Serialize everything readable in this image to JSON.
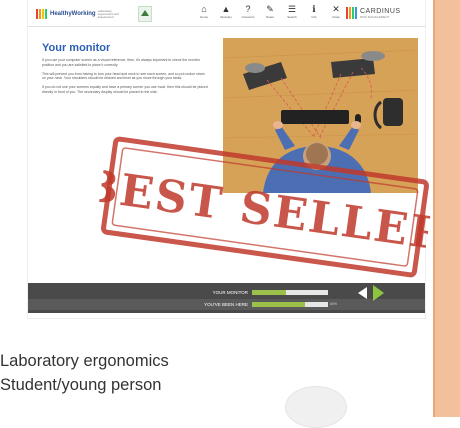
{
  "colors": {
    "brand_blue": "#2b5fb5",
    "rail": "#f2c09a",
    "bar_bg": "#4a4a4a",
    "progress_green": "#9bc14a",
    "stamp_red": "#c0392b"
  },
  "app": {
    "brand_name": "HealthyWorking",
    "brand_sub": "ergonomics",
    "brand_tagline": "Laboratory ergonomics self assessment",
    "partner_name": "CARDINUS",
    "partner_sub": "RISK MANAGEMENT"
  },
  "nav": [
    {
      "label": "Home",
      "icon": "house-icon",
      "glyph": "⌂"
    },
    {
      "label": "Glossary",
      "icon": "car-icon",
      "glyph": "▲"
    },
    {
      "label": "Concerns",
      "icon": "help-icon",
      "glyph": "?"
    },
    {
      "label": "Notes",
      "icon": "pen-icon",
      "glyph": "✎"
    },
    {
      "label": "Search",
      "icon": "menu-icon",
      "glyph": "☰"
    },
    {
      "label": "Info",
      "icon": "info-icon",
      "glyph": "ℹ"
    },
    {
      "label": "Close",
      "icon": "close-icon",
      "glyph": "✕"
    }
  ],
  "page": {
    "title": "Your monitor",
    "paragraphs": [
      "If you use your computer screen as a visual reference, then, it's always important to check the monitor position and you are satisfied to place it correctly.",
      "This will prevent you from having to turn your head and neck to see each screen, and so put undue strain on your neck. Your shoulders should be relaxed and level as you move through your tasks.",
      "If you do not use your screens equally and have a primary screen you use most, then this should be placed directly in front of you. The secondary display should be placed to the side."
    ]
  },
  "stamp": {
    "text": "BEST SELLER"
  },
  "progress": [
    {
      "label": "YOUR MONITOR",
      "value": 0.45,
      "pct": ""
    },
    {
      "label": "YOU'VE BEEN HERE",
      "value": 0.7,
      "pct": "60%"
    }
  ],
  "captions": [
    "Laboratory ergonomics",
    "Student/young person"
  ]
}
